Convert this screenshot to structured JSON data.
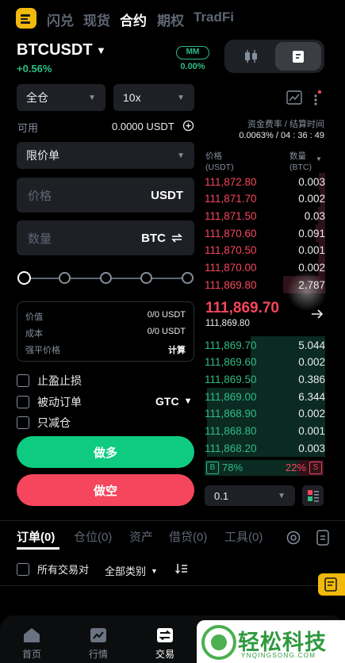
{
  "nav": {
    "tabs": [
      "闪兑",
      "现货",
      "合约",
      "期权",
      "TradFi"
    ],
    "active": "合约"
  },
  "market": {
    "symbol": "BTCUSDT",
    "change": "+0.56%",
    "mm_label": "MM",
    "mm_value": "0.00%"
  },
  "order_form": {
    "margin_mode": "全仓",
    "leverage": "10x",
    "available_label": "可用",
    "available_value": "0.0000 USDT",
    "order_type": "限价单",
    "price_placeholder": "价格",
    "price_unit": "USDT",
    "qty_placeholder": "数量",
    "qty_unit": "BTC",
    "slider_level": 0,
    "info": {
      "value_label": "价值",
      "value": "0/0 USDT",
      "cost_label": "成本",
      "cost": "0/0 USDT",
      "liq_label": "强平价格",
      "liq_value": "计算"
    },
    "tp_sl": "止盈止损",
    "post_only": "被动订单",
    "tif": "GTC",
    "reduce_only": "只减仓",
    "buy_label": "做多",
    "sell_label": "做空"
  },
  "funding": {
    "label": "资金费率 / 结算时间",
    "value": "0.0063% / 04 : 36 : 49"
  },
  "orderbook": {
    "price_header": "价格",
    "price_unit": "(USDT)",
    "qty_header": "数量",
    "qty_unit": "(BTC)",
    "asks": [
      {
        "price": "111,872.80",
        "qty": "0.003",
        "depth": 0.05
      },
      {
        "price": "111,871.70",
        "qty": "0.002",
        "depth": 0.04
      },
      {
        "price": "111,871.50",
        "qty": "0.03",
        "depth": 0.06
      },
      {
        "price": "111,870.60",
        "qty": "0.091",
        "depth": 0.08
      },
      {
        "price": "111,870.50",
        "qty": "0.001",
        "depth": 0.05
      },
      {
        "price": "111,870.00",
        "qty": "0.002",
        "depth": 0.06
      },
      {
        "price": "111,869.80",
        "qty": "2.787",
        "depth": 0.35
      }
    ],
    "last_price": "111,869.70",
    "mark_price": "111,869.80",
    "bids": [
      {
        "price": "111,869.70",
        "qty": "5.044",
        "depth": 0.62
      },
      {
        "price": "111,869.60",
        "qty": "0.002",
        "depth": 0.62
      },
      {
        "price": "111,869.50",
        "qty": "0.386",
        "depth": 0.62
      },
      {
        "price": "111,869.00",
        "qty": "6.344",
        "depth": 0.98
      },
      {
        "price": "111,868.90",
        "qty": "0.002",
        "depth": 0.98
      },
      {
        "price": "111,868.80",
        "qty": "0.001",
        "depth": 0.98
      },
      {
        "price": "111,868.20",
        "qty": "0.003",
        "depth": 0.98
      }
    ],
    "ratio_buy_tag": "B",
    "ratio_buy": "78%",
    "ratio_buy_fraction": 0.78,
    "ratio_sell": "22%",
    "ratio_sell_tag": "S",
    "precision": "0.1"
  },
  "bottom_tabs": {
    "tabs": [
      "订单(0)",
      "仓位(0)",
      "资产",
      "借贷(0)",
      "工具(0)"
    ],
    "active": "订单(0)",
    "all_pairs": "所有交易对",
    "all_types": "全部类别"
  },
  "bottom_nav": {
    "items": [
      "首页",
      "行情",
      "交易"
    ],
    "active": "交易"
  },
  "watermark": {
    "name": "轻松科技",
    "url": "YNQINGSONG.COM"
  },
  "colors": {
    "up": "#2ebd85",
    "down": "#f6465d",
    "accent": "#f0b90b",
    "panel": "#1e2026"
  }
}
